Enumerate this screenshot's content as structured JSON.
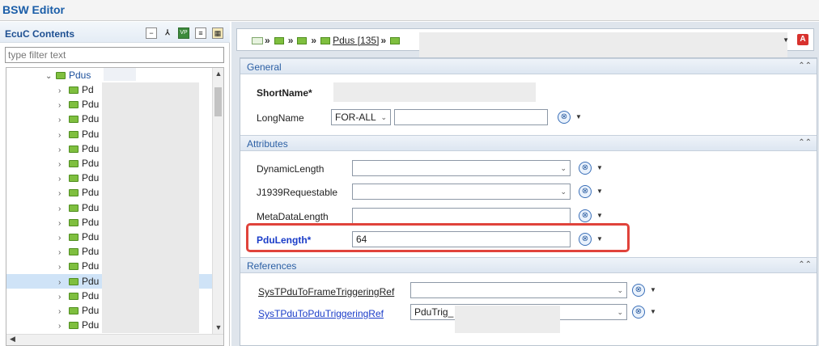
{
  "window": {
    "title": "BSW Editor"
  },
  "left_panel": {
    "title": "EcuC Contents",
    "filter_placeholder": "type filter text",
    "toolbar_icons": [
      "collapse-all-icon",
      "link-icon",
      "vp-icon",
      "document-icon",
      "grid-icon"
    ],
    "tree": {
      "root_label": "Pdus",
      "children": [
        "Pd",
        "Pdu",
        "Pdu",
        "Pdu",
        "Pdu",
        "Pdu",
        "Pdu",
        "Pdu",
        "Pdu",
        "Pdu",
        "Pdu",
        "Pdu",
        "Pdu",
        "Pdu",
        "Pdu",
        "Pdu",
        "Pdu",
        "Pdu"
      ],
      "selected_index": 13
    }
  },
  "breadcrumb": {
    "items": [
      "Pdus [135]"
    ]
  },
  "sections": {
    "general": {
      "title": "General",
      "shortname_label": "ShortName*",
      "longname_label": "LongName",
      "longname_lang": "FOR-ALL"
    },
    "attributes": {
      "title": "Attributes",
      "dynamic_length_label": "DynamicLength",
      "j1939_label": "J1939Requestable",
      "metadata_label": "MetaDataLength",
      "pdulength_label": "PduLength*",
      "pdulength_value": "64"
    },
    "references": {
      "title": "References",
      "frame_ref_label": "SysTPduToFrameTriggeringRef",
      "pdu_ref_label": "SysTPduToPduTriggeringRef",
      "pdu_ref_value": "PduTrig_"
    }
  },
  "colors": {
    "accent": "#1b5ea8",
    "highlight": "#e0433b",
    "folder": "#7fbf3f"
  }
}
